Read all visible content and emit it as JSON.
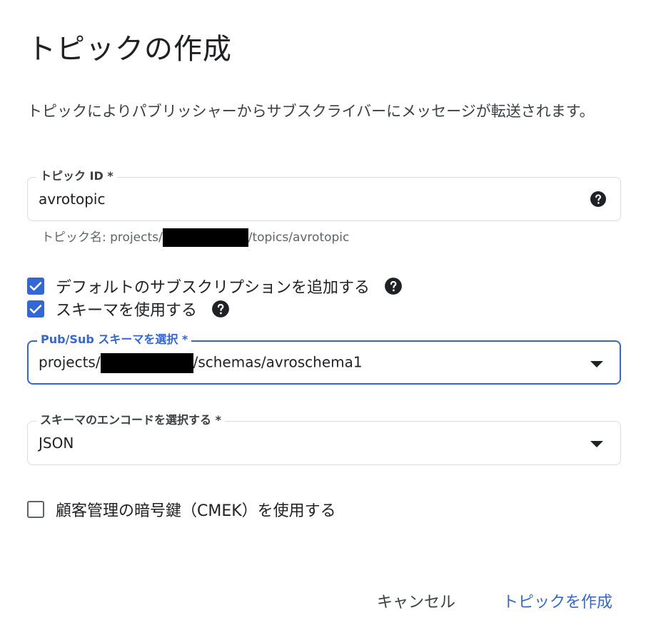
{
  "dialog": {
    "title": "トピックの作成",
    "description": "トピックによりパブリッシャーからサブスクライバーにメッセージが転送されます。"
  },
  "topic_id": {
    "label": "トピック ID *",
    "value": "avrotopic",
    "hint_prefix": "トピック名: projects/",
    "hint_suffix": "/topics/avrotopic",
    "help_icon": "help-circle-icon"
  },
  "options": {
    "default_subscription": {
      "label": "デフォルトのサブスクリプションを追加する",
      "checked": true
    },
    "use_schema": {
      "label": "スキーマを使用する",
      "checked": true
    },
    "cmek": {
      "label": "顧客管理の暗号鍵（CMEK）を使用する",
      "checked": false
    }
  },
  "schema_select": {
    "label": "Pub/Sub スキーマを選択 *",
    "value_prefix": "projects/",
    "value_suffix": "/schemas/avroschema1"
  },
  "encoding_select": {
    "label": "スキーマのエンコードを選択する *",
    "value": "JSON"
  },
  "actions": {
    "cancel": "キャンセル",
    "create": "トピックを作成"
  },
  "colors": {
    "accent": "#3367d6",
    "text": "#202124",
    "muted": "#5f6368",
    "border": "#dadce0"
  }
}
